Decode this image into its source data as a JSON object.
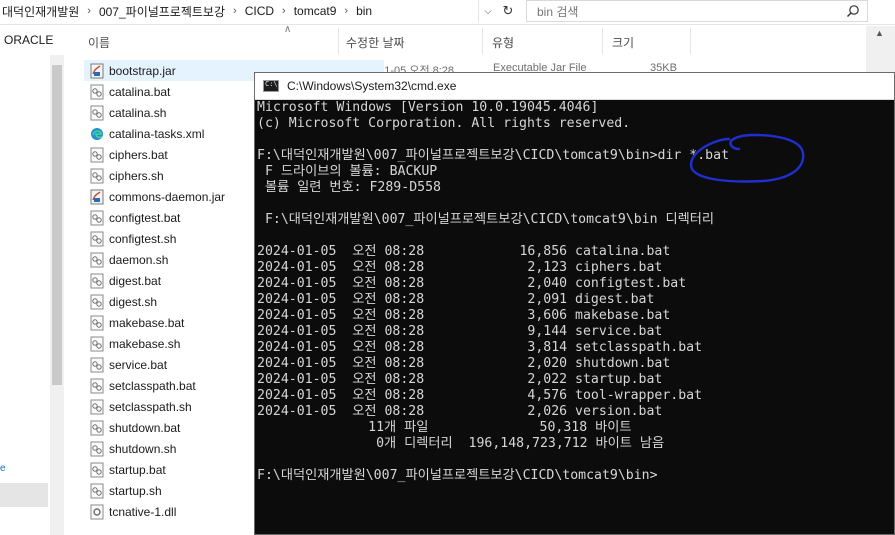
{
  "explorer": {
    "breadcrumb": [
      "대덕인재개발원",
      "007_파이널프로젝트보강",
      "CICD",
      "tomcat9",
      "bin"
    ],
    "search_placeholder": "bin 검색",
    "nav": {
      "visible_item": "ORACLE",
      "small_link": "e"
    },
    "columns": {
      "name": "이름",
      "date": "수정한 날짜",
      "type": "유형",
      "size": "크기"
    },
    "obscured_row": {
      "date": "2024-01-05 오전 8:28",
      "type": "Executable Jar File",
      "size": "35KB"
    },
    "files": [
      {
        "name": "bootstrap.jar",
        "icon": "jar-file-icon"
      },
      {
        "name": "catalina.bat",
        "icon": "batch-file-icon"
      },
      {
        "name": "catalina.sh",
        "icon": "shell-file-icon"
      },
      {
        "name": "catalina-tasks.xml",
        "icon": "edge-xml-icon"
      },
      {
        "name": "ciphers.bat",
        "icon": "batch-file-icon"
      },
      {
        "name": "ciphers.sh",
        "icon": "shell-file-icon"
      },
      {
        "name": "commons-daemon.jar",
        "icon": "jar-file-icon"
      },
      {
        "name": "configtest.bat",
        "icon": "batch-file-icon"
      },
      {
        "name": "configtest.sh",
        "icon": "shell-file-icon"
      },
      {
        "name": "daemon.sh",
        "icon": "shell-file-icon"
      },
      {
        "name": "digest.bat",
        "icon": "batch-file-icon"
      },
      {
        "name": "digest.sh",
        "icon": "shell-file-icon"
      },
      {
        "name": "makebase.bat",
        "icon": "batch-file-icon"
      },
      {
        "name": "makebase.sh",
        "icon": "shell-file-icon"
      },
      {
        "name": "service.bat",
        "icon": "batch-file-icon"
      },
      {
        "name": "setclasspath.bat",
        "icon": "batch-file-icon"
      },
      {
        "name": "setclasspath.sh",
        "icon": "shell-file-icon"
      },
      {
        "name": "shutdown.bat",
        "icon": "batch-file-icon"
      },
      {
        "name": "shutdown.sh",
        "icon": "shell-file-icon"
      },
      {
        "name": "startup.bat",
        "icon": "batch-file-icon"
      },
      {
        "name": "startup.sh",
        "icon": "shell-file-icon"
      },
      {
        "name": "tcnative-1.dll",
        "icon": "dll-file-icon"
      }
    ]
  },
  "cmd": {
    "title": "C:\\Windows\\System32\\cmd.exe",
    "lines": [
      "Microsoft Windows [Version 10.0.19045.4046]",
      "(c) Microsoft Corporation. All rights reserved.",
      "",
      "F:\\대덕인재개발원\\007_파이널프로젝트보강\\CICD\\tomcat9\\bin>dir *.bat",
      " F 드라이브의 볼륨: BACKUP",
      " 볼륨 일련 번호: F289-D558",
      "",
      " F:\\대덕인재개발원\\007_파이널프로젝트보강\\CICD\\tomcat9\\bin 디렉터리",
      "",
      "2024-01-05  오전 08:28            16,856 catalina.bat",
      "2024-01-05  오전 08:28             2,123 ciphers.bat",
      "2024-01-05  오전 08:28             2,040 configtest.bat",
      "2024-01-05  오전 08:28             2,091 digest.bat",
      "2024-01-05  오전 08:28             3,606 makebase.bat",
      "2024-01-05  오전 08:28             9,144 service.bat",
      "2024-01-05  오전 08:28             3,814 setclasspath.bat",
      "2024-01-05  오전 08:28             2,020 shutdown.bat",
      "2024-01-05  오전 08:28             2,022 startup.bat",
      "2024-01-05  오전 08:28             4,576 tool-wrapper.bat",
      "2024-01-05  오전 08:28             2,026 version.bat",
      "              11개 파일              50,318 바이트",
      "               0개 디렉터리  196,148,723,712 바이트 남음",
      "",
      "F:\\대덕인재개발원\\007_파이널프로젝트보강\\CICD\\tomcat9\\bin>"
    ]
  },
  "colors": {
    "console_bg": "#0c0c0c",
    "console_fg": "#d6d6d6",
    "annotation": "#1f2fd0",
    "selection": "#e5f3ff"
  }
}
